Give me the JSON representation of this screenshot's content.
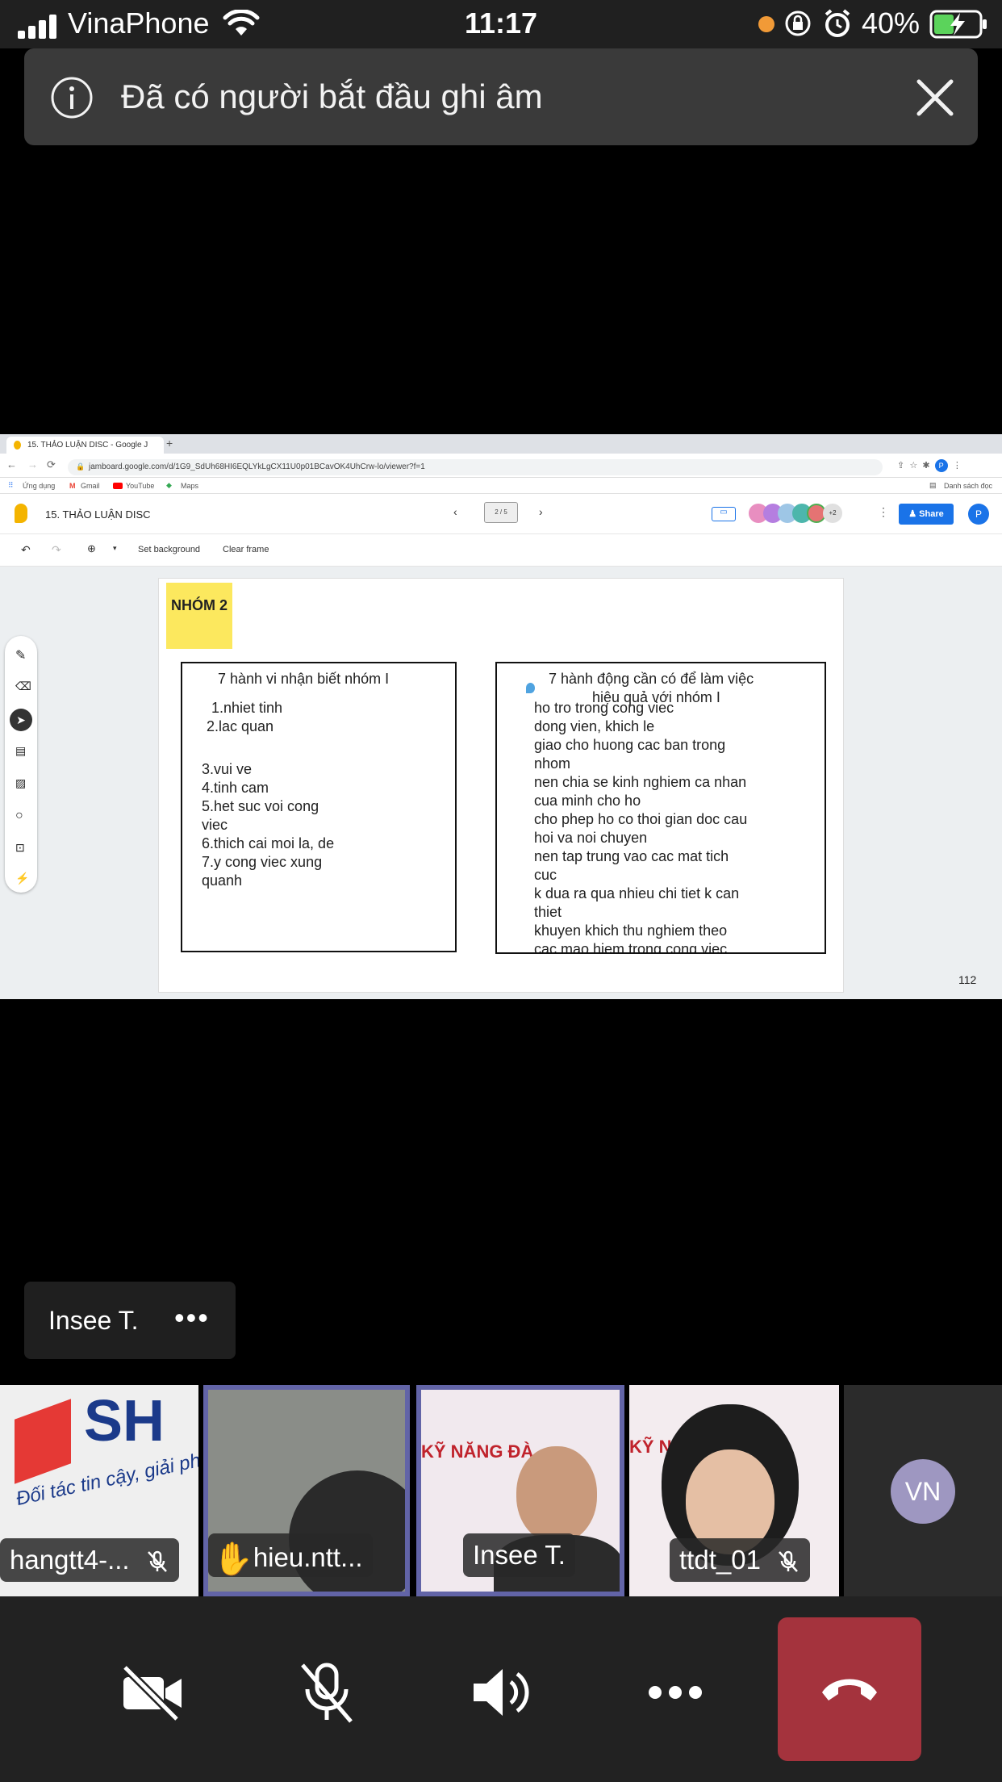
{
  "status_bar": {
    "carrier": "VinaPhone",
    "time": "11:17",
    "battery": "40%"
  },
  "toast": {
    "message": "Đã có người bắt đầu ghi âm"
  },
  "shared_screen": {
    "browser_tab_title": "15. THẢO LUẬN DISC - Google J",
    "url": "jamboard.google.com/d/1G9_SdUh68HI6EQLYkLgCX11U0p01BCavOK4UhCrw-lo/viewer?f=1",
    "bookmarks": [
      "Ứng dụng",
      "Gmail",
      "YouTube",
      "Maps"
    ],
    "bookmark_right": "Danh sách đọc",
    "doc_title": "15. THẢO LUẬN DISC",
    "frame_counter": "2 / 5",
    "share_label": "Share",
    "profile_initial": "P",
    "collaborators_more": "+2",
    "toolbar": {
      "set_background": "Set background",
      "clear_frame": "Clear frame"
    },
    "sticky_note": "NHÓM 2",
    "left_box": {
      "title": "7 hành vi nhận biết nhóm I",
      "lines": [
        "1.nhiet tinh",
        "2.lac quan",
        "",
        "3.vui ve",
        "4.tinh cam",
        "5.het suc voi cong",
        "viec",
        "6.thich cai moi la, de",
        "7.y cong viec xung",
        "quanh"
      ]
    },
    "right_box": {
      "title_line1": "7 hành động cần có để làm việc",
      "title_line2": "hiệu quả với nhóm I",
      "lines": [
        "ho tro trong cong viec",
        "dong vien, khich le",
        "giao cho huong cac ban trong",
        "nhom",
        "nen chia se kinh nghiem ca nhan",
        "cua minh cho ho",
        "cho phep ho co thoi gian doc cau",
        "hoi va noi chuyen",
        "nen tap trung vao cac mat tich",
        "cuc",
        "k dua ra qua nhieu chi tiet k can",
        "thiet",
        "khuyen khich thu nghiem theo",
        "cac mao hiem trong cong viec"
      ]
    },
    "page_number": "112"
  },
  "presenter_label": {
    "name": "Insee T.",
    "more": "•••"
  },
  "participants": [
    {
      "name": "hangtt4-...",
      "muted": true,
      "hand_raised": false,
      "active": false,
      "bg_text": "Đối tác tin cậy, giải ph"
    },
    {
      "name": "hieu.ntt...",
      "muted": false,
      "hand_raised": true,
      "active": true
    },
    {
      "name": "Insee T.",
      "muted": false,
      "hand_raised": false,
      "active": true,
      "bg_text": "KỸ NĂNG ĐÀ"
    },
    {
      "name": "ttdt_01",
      "muted": true,
      "hand_raised": false,
      "active": false,
      "bg_text": "KỸ N"
    },
    {
      "initials": "VN",
      "avatar_color": "#9e97c1"
    }
  ],
  "colors": {
    "status_bar_bg": "#202020",
    "toast_bg": "#3a3a3a",
    "active_speaker": "#6264a7",
    "hangup": "#a4333d",
    "call_bar_bg": "#222222",
    "sticky": "#fce85e",
    "share_blue": "#1a73e8"
  }
}
